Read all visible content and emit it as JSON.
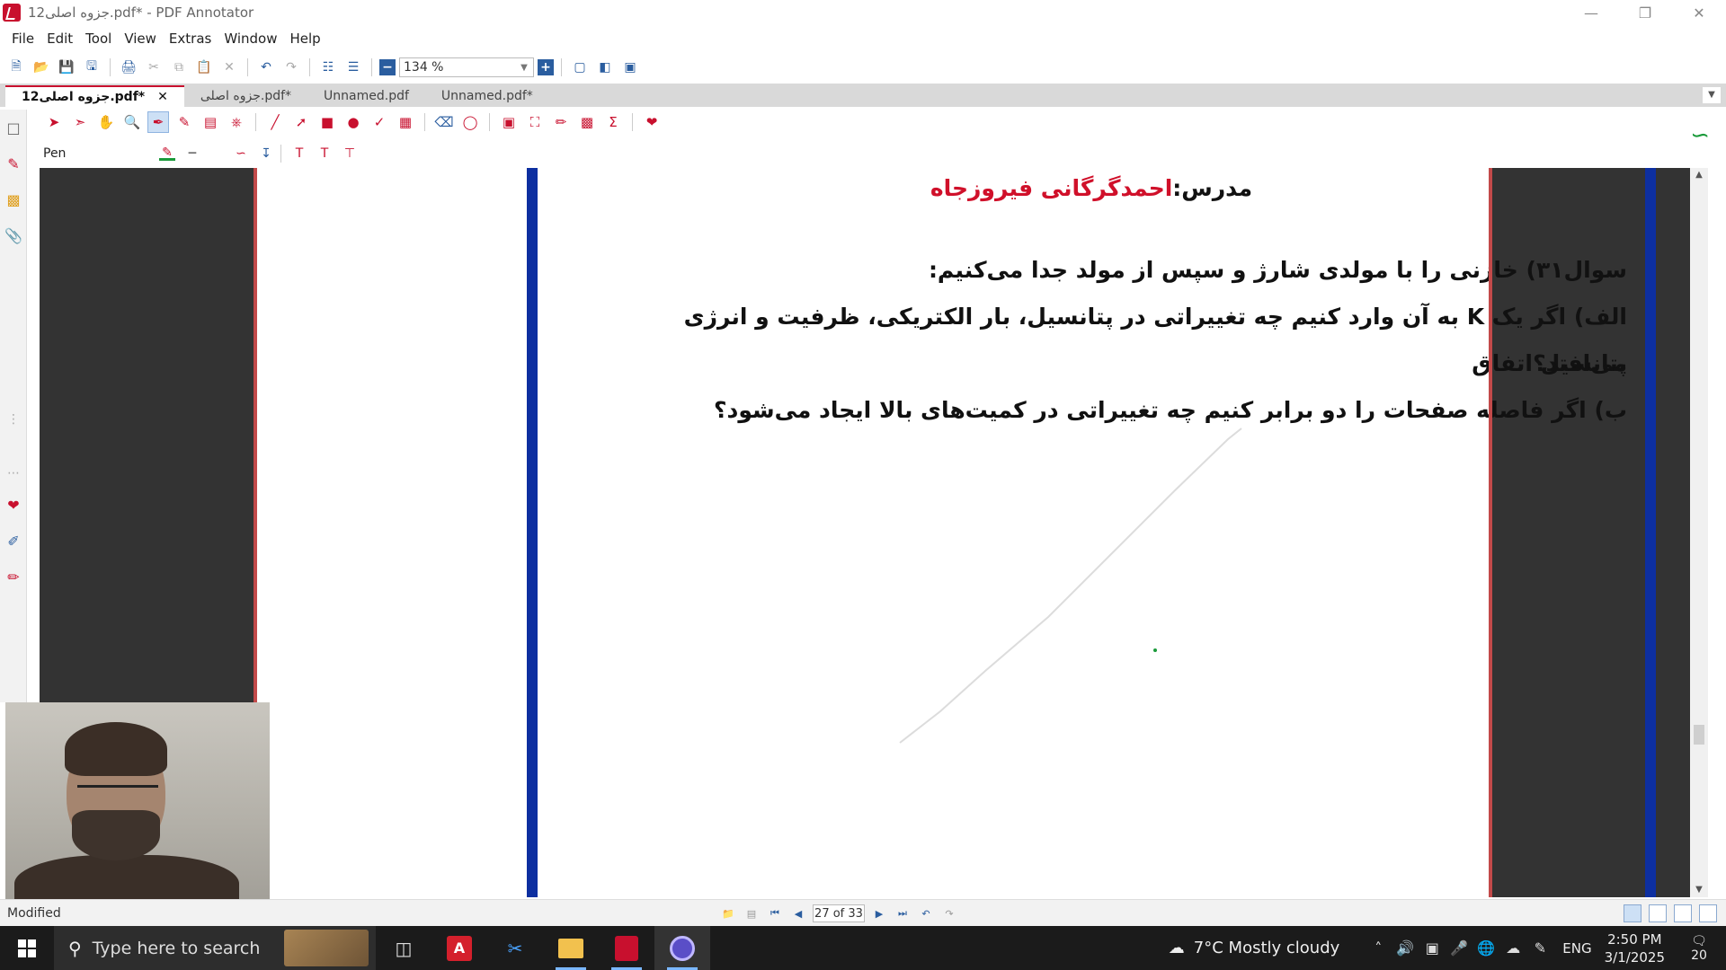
{
  "window": {
    "title": "12جزوه اصلی.pdf* - PDF Annotator",
    "controls": [
      "minimize",
      "restore",
      "close"
    ]
  },
  "menu": [
    "File",
    "Edit",
    "Tool",
    "View",
    "Extras",
    "Window",
    "Help"
  ],
  "toolbar": {
    "zoom_value": "134 %"
  },
  "tabs": [
    {
      "label": "12جزوه اصلی.pdf*",
      "active": true
    },
    {
      "label": "جزوه اصلی.pdf*",
      "active": false
    },
    {
      "label": "Unnamed.pdf",
      "active": false
    },
    {
      "label": "Unnamed.pdf*",
      "active": false
    }
  ],
  "annotation_bar": {
    "tool_name": "Pen",
    "pen_color": "#1a9a3a"
  },
  "document": {
    "teacher_label": "مدرس:",
    "teacher_name": "احمدگرگانی فیروزجاه",
    "lines": [
      "سوال۳۱) خازنی را با مولدی شارژ و سپس از مولد جدا می‌کنیم:",
      "الف) اگر یک K به آن وارد کنیم چه تغییراتی در پتانسیل، بار الکتریکی، ظرفیت و انرژی پتانسیل اتفاق",
      "می‌افتد؟",
      "ب) اگر فاصله صفحات را دو برابر کنیم چه تغییراتی در کمیت‌های بالا ایجاد می‌شود؟"
    ],
    "frame_color": "#0d2fa0",
    "name_color": "#d0102a"
  },
  "status": {
    "text": "Modified",
    "page_indicator": "27 of 33"
  },
  "taskbar": {
    "search_placeholder": "Type here to search",
    "weather": "7°C  Mostly cloudy",
    "language": "ENG",
    "time": "2:50 PM",
    "date": "3/1/2025",
    "notifications": "20"
  }
}
